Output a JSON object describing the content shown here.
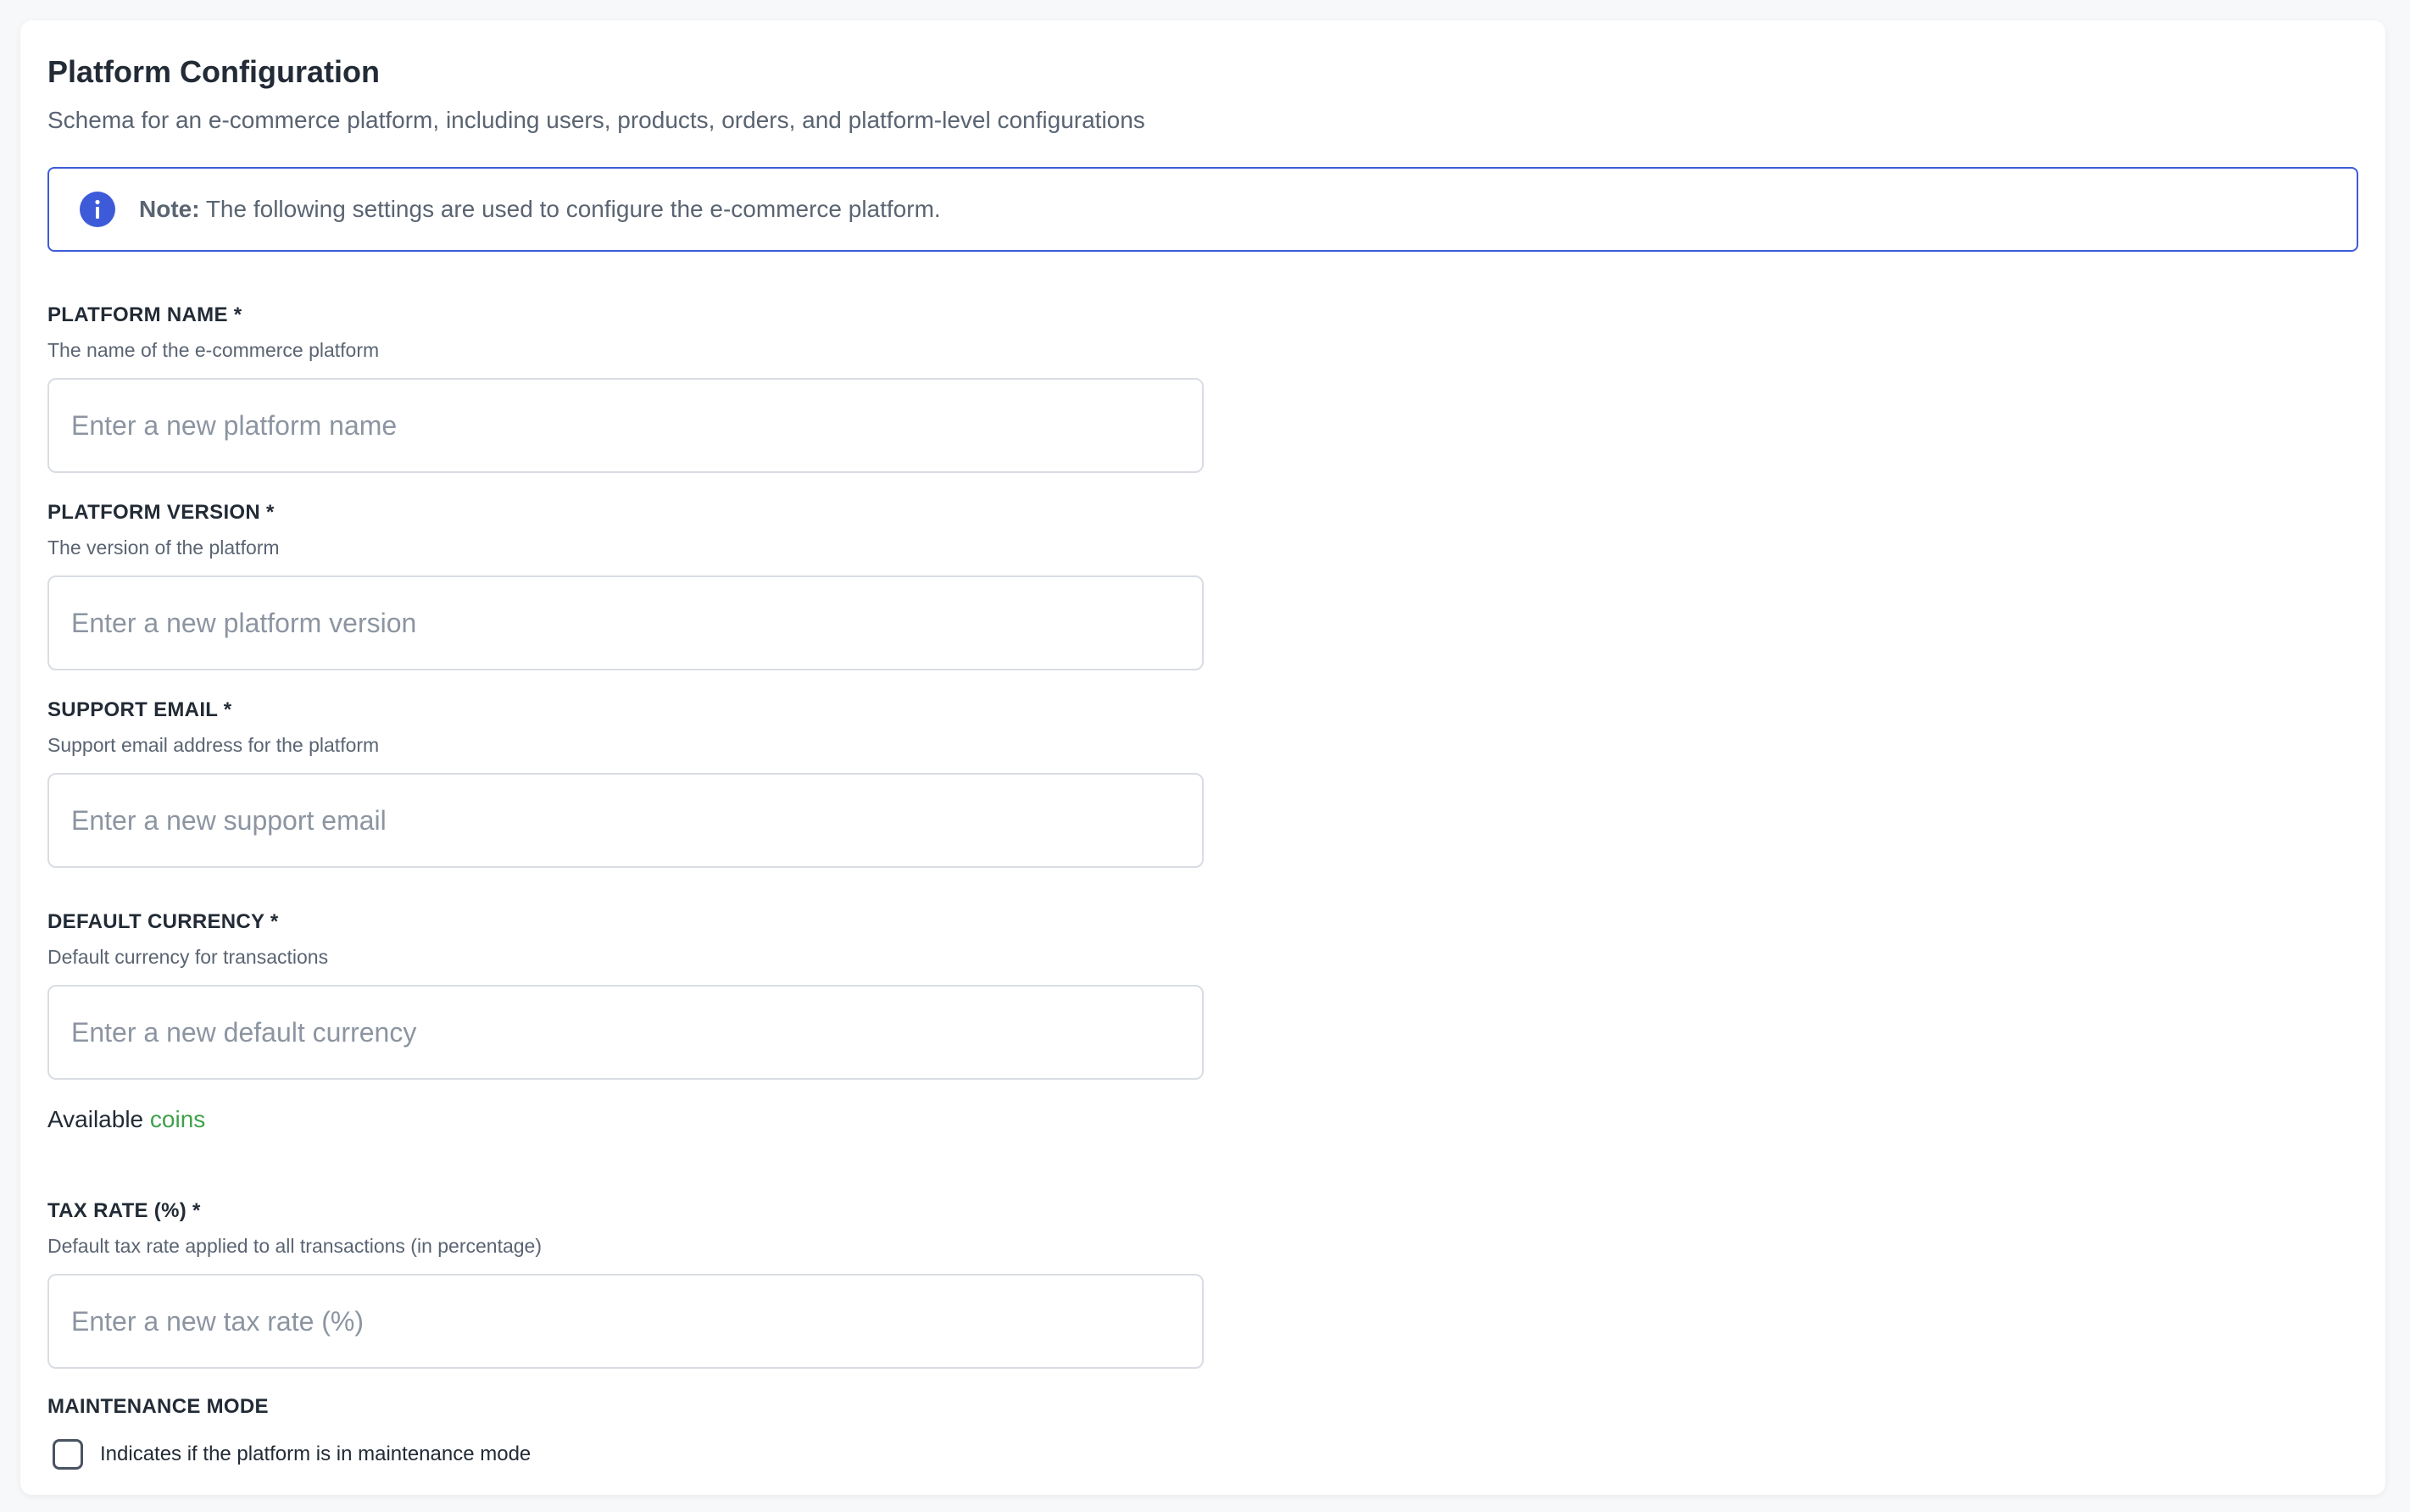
{
  "form": {
    "title": "Platform Configuration",
    "subtitle": "Schema for an e-commerce platform, including users, products, orders, and platform-level configurations",
    "note": {
      "icon": "info-icon",
      "strong": "Note:",
      "text": " The following settings are used to configure the e-commerce platform."
    },
    "fields": {
      "platform_name": {
        "label": "PLATFORM NAME *",
        "help": "The name of the e-commerce platform",
        "placeholder": "Enter a new platform name",
        "value": ""
      },
      "platform_version": {
        "label": "PLATFORM VERSION *",
        "help": "The version of the platform",
        "placeholder": "Enter a new platform version",
        "value": ""
      },
      "support_email": {
        "label": "SUPPORT EMAIL *",
        "help": "Support email address for the platform",
        "placeholder": "Enter a new support email",
        "value": ""
      },
      "default_currency": {
        "label": "DEFAULT CURRENCY *",
        "help": "Default currency for transactions",
        "placeholder": "Enter a new default currency",
        "value": ""
      },
      "tax_rate": {
        "label": "TAX RATE (%) *",
        "help": "Default tax rate applied to all transactions (in percentage)",
        "placeholder": "Enter a new tax rate (%)",
        "value": ""
      }
    },
    "available": {
      "prefix": "Available",
      "link": "coins"
    },
    "maintenance": {
      "label": "MAINTENANCE MODE",
      "checkbox_text": "Indicates if the platform is in maintenance mode",
      "checked": false
    }
  },
  "colors": {
    "accent": "#3d5bd9",
    "link_green": "#3fa149",
    "text_primary": "#222b36",
    "text_secondary": "#5a6472",
    "border": "#d9dde3"
  }
}
